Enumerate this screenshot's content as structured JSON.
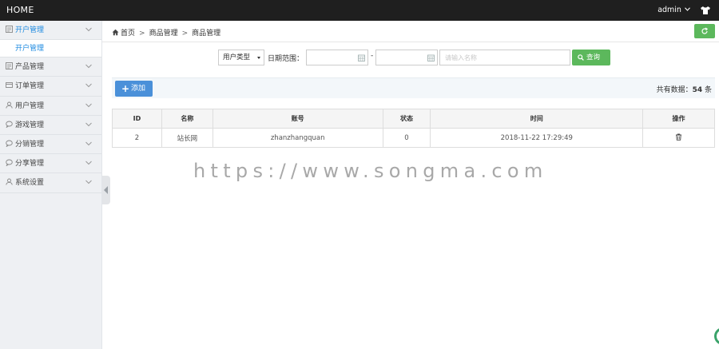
{
  "topbar": {
    "brand": "HOME",
    "user": "admin"
  },
  "sidebar": {
    "items": [
      {
        "label": "开户管理",
        "active": true,
        "icon": "list-icon"
      },
      {
        "label": "产品管理",
        "icon": "list-icon"
      },
      {
        "label": "订单管理",
        "icon": "card-icon"
      },
      {
        "label": "用户管理",
        "icon": "user-icon"
      },
      {
        "label": "游戏管理",
        "icon": "chat-icon"
      },
      {
        "label": "分销管理",
        "icon": "chat-icon"
      },
      {
        "label": "分享管理",
        "icon": "chat-icon"
      },
      {
        "label": "系统设置",
        "icon": "user-icon"
      }
    ],
    "subitem": "开户管理"
  },
  "breadcrumb": {
    "home": "首页",
    "level1": "商品管理",
    "level2": "商品管理"
  },
  "filters": {
    "user_type": "用户类型",
    "date_label": "日期范围：",
    "dash": "-",
    "name_placeholder": "请输入名称",
    "search_label": "查询"
  },
  "toolbar": {
    "add_label": "添加",
    "total_prefix": "共有数据：",
    "total_count": "54",
    "total_suffix": "条"
  },
  "table": {
    "headers": [
      "ID",
      "名称",
      "账号",
      "状态",
      "时间",
      "操作"
    ],
    "rows": [
      {
        "id": "2",
        "name": "站长网",
        "account": "zhanzhangquan",
        "status": "0",
        "time": "2018-11-22 17:29:49"
      }
    ]
  },
  "watermark": "https://www.songma.com",
  "colors": {
    "accent": "#1d8ae0",
    "green": "#5cb85c",
    "add_blue": "#4a90d9",
    "topbar": "#1f1f1f"
  }
}
